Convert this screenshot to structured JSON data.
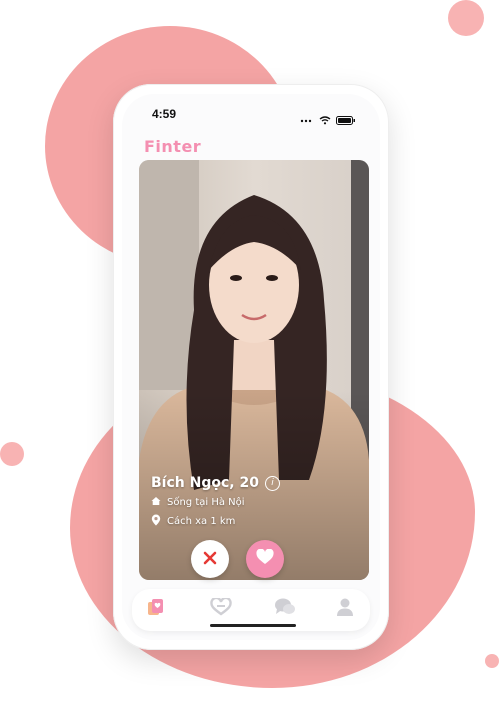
{
  "status": {
    "time": "4:59"
  },
  "app": {
    "title": "Finter"
  },
  "profile": {
    "name_age": "Bích Ngọc, 20",
    "hometown": "Sống tại Hà Nội",
    "distance": "Cách xa 1 km"
  },
  "actions": {
    "dislike_icon": "close-x",
    "like_icon": "heart"
  },
  "tabs": [
    {
      "icon": "cards-icon",
      "active": true
    },
    {
      "icon": "match-icon",
      "active": false
    },
    {
      "icon": "chat-icon",
      "active": false
    },
    {
      "icon": "profile-icon",
      "active": false
    }
  ],
  "colors": {
    "accent": "#f48fb1",
    "blob": "#f39a9a",
    "dislike": "#e53935"
  }
}
